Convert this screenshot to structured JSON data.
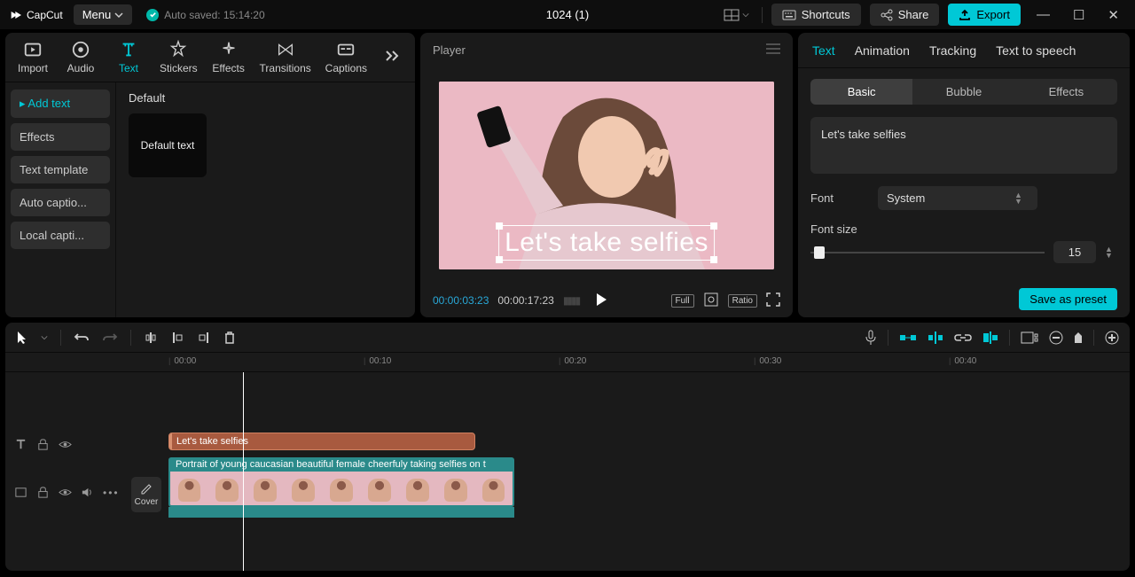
{
  "app_name": "CapCut",
  "menu_label": "Menu",
  "autosave": "Auto saved: 15:14:20",
  "project_title": "1024 (1)",
  "titlebar": {
    "shortcuts": "Shortcuts",
    "share": "Share",
    "export": "Export"
  },
  "library": {
    "tabs": {
      "import": "Import",
      "audio": "Audio",
      "text": "Text",
      "stickers": "Stickers",
      "effects": "Effects",
      "transitions": "Transitions",
      "captions": "Captions"
    },
    "side": {
      "add_text": "▸ Add text",
      "effects": "Effects",
      "text_template": "Text template",
      "auto_captions": "Auto captio...",
      "local_captions": "Local capti..."
    },
    "heading": "Default",
    "preset": "Default text"
  },
  "player": {
    "label": "Player",
    "overlay_text": "Let's take selfies",
    "time_current": "00:00:03:23",
    "time_total": "00:00:17:23",
    "full": "Full",
    "ratio": "Ratio"
  },
  "inspector": {
    "tabs": {
      "text": "Text",
      "animation": "Animation",
      "tracking": "Tracking",
      "tts": "Text to speech"
    },
    "subtabs": {
      "basic": "Basic",
      "bubble": "Bubble",
      "effects": "Effects"
    },
    "text_value": "Let's take selfies",
    "font_label": "Font",
    "font_value": "System",
    "fontsize_label": "Font size",
    "fontsize_value": "15",
    "save_preset": "Save as preset"
  },
  "timeline": {
    "ticks": [
      "00:00",
      "00:10",
      "00:20",
      "00:30",
      "00:40"
    ],
    "cover": "Cover",
    "text_clip": "Let's take selfies",
    "video_clip": "Portrait of young caucasian beautiful female cheerfuly taking selfies on t"
  }
}
